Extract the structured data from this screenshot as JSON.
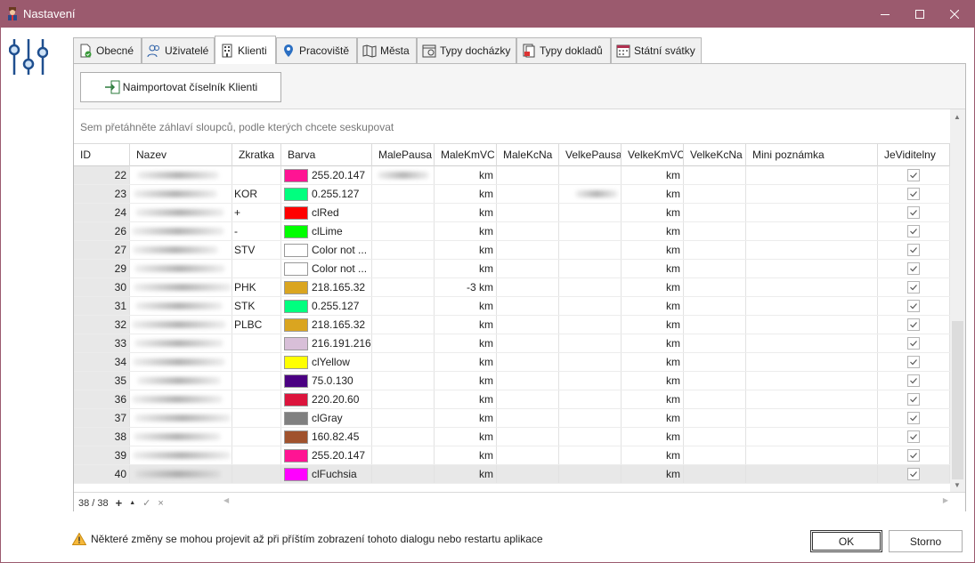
{
  "window": {
    "title": "Nastavení"
  },
  "tabs": [
    {
      "label": "Obecné",
      "icon": "document-check-icon"
    },
    {
      "label": "Uživatelé",
      "icon": "users-icon"
    },
    {
      "label": "Klienti",
      "icon": "building-icon",
      "active": true
    },
    {
      "label": "Pracoviště",
      "icon": "map-pin-icon"
    },
    {
      "label": "Města",
      "icon": "map-icon"
    },
    {
      "label": "Typy docházky",
      "icon": "attendance-icon"
    },
    {
      "label": "Typy dokladů",
      "icon": "documents-icon"
    },
    {
      "label": "Státní svátky",
      "icon": "calendar-icon"
    }
  ],
  "import_button": {
    "label": "Naimportovat číselník Klienti"
  },
  "grid": {
    "group_panel_text": "Sem přetáhněte záhlaví sloupců, podle kterých chcete seskupovat",
    "columns": [
      "ID",
      "Nazev",
      "Zkratka",
      "Barva",
      "MalePausa",
      "MaleKmVC",
      "MaleKcNa",
      "VelkePausa",
      "VelkeKmVC",
      "VelkeKcNa",
      "Mini poznámka",
      "JeViditelny"
    ],
    "rows": [
      {
        "id": "22",
        "zkratka": "",
        "color": "#ff1493",
        "color_text": "255.20.147",
        "male_km": "km",
        "velke_km": "km",
        "visible": true
      },
      {
        "id": "23",
        "zkratka": "KOR",
        "color": "#00ff7f",
        "color_text": "0.255.127",
        "male_km": "km",
        "velke_km": "km",
        "visible": true
      },
      {
        "id": "24",
        "zkratka": "+",
        "color": "#ff0000",
        "color_text": "clRed",
        "male_km": "km",
        "velke_km": "km",
        "visible": true
      },
      {
        "id": "26",
        "zkratka": "-",
        "color": "#00ff00",
        "color_text": "clLime",
        "male_km": "km",
        "velke_km": "km",
        "visible": true
      },
      {
        "id": "27",
        "zkratka": "STV",
        "color": "#ffffff",
        "color_text": "Color not ...",
        "male_km": "km",
        "velke_km": "km",
        "visible": true
      },
      {
        "id": "29",
        "zkratka": "",
        "color": "#ffffff",
        "color_text": "Color not ...",
        "male_km": "km",
        "velke_km": "km",
        "visible": true
      },
      {
        "id": "30",
        "zkratka": "PHK",
        "color": "#daa520",
        "color_text": "218.165.32",
        "male_km": "-3 km",
        "velke_km": "km",
        "visible": true
      },
      {
        "id": "31",
        "zkratka": "STK",
        "color": "#00ff7f",
        "color_text": "0.255.127",
        "male_km": "km",
        "velke_km": "km",
        "visible": true
      },
      {
        "id": "32",
        "zkratka": "PLBC",
        "color": "#daa520",
        "color_text": "218.165.32",
        "male_km": "km",
        "velke_km": "km",
        "visible": true
      },
      {
        "id": "33",
        "zkratka": "",
        "color": "#d8bfd8",
        "color_text": "216.191.216",
        "male_km": "km",
        "velke_km": "km",
        "visible": true
      },
      {
        "id": "34",
        "zkratka": "",
        "color": "#ffff00",
        "color_text": "clYellow",
        "male_km": "km",
        "velke_km": "km",
        "visible": true
      },
      {
        "id": "35",
        "zkratka": "",
        "color": "#4b0082",
        "color_text": "75.0.130",
        "male_km": "km",
        "velke_km": "km",
        "visible": true
      },
      {
        "id": "36",
        "zkratka": "",
        "color": "#dc143c",
        "color_text": "220.20.60",
        "male_km": "km",
        "velke_km": "km",
        "visible": true
      },
      {
        "id": "37",
        "zkratka": "",
        "color": "#808080",
        "color_text": "clGray",
        "male_km": "km",
        "velke_km": "km",
        "visible": true
      },
      {
        "id": "38",
        "zkratka": "",
        "color": "#a0522d",
        "color_text": "160.82.45",
        "male_km": "km",
        "velke_km": "km",
        "visible": true
      },
      {
        "id": "39",
        "zkratka": "",
        "color": "#ff1493",
        "color_text": "255.20.147",
        "male_km": "km",
        "velke_km": "km",
        "visible": true
      },
      {
        "id": "40",
        "zkratka": "",
        "color": "#ff00ff",
        "color_text": "clFuchsia",
        "male_km": "km",
        "velke_km": "km",
        "visible": true,
        "selected": true
      }
    ],
    "footer": {
      "record_counter": "38 / 38",
      "add": "+",
      "up": "▲",
      "confirm": "✓",
      "cancel": "×"
    }
  },
  "warning_text": "Některé změny se mohou projevit až při příštím zobrazení tohoto dialogu nebo restartu aplikace",
  "buttons": {
    "ok": "OK",
    "cancel": "Storno"
  }
}
